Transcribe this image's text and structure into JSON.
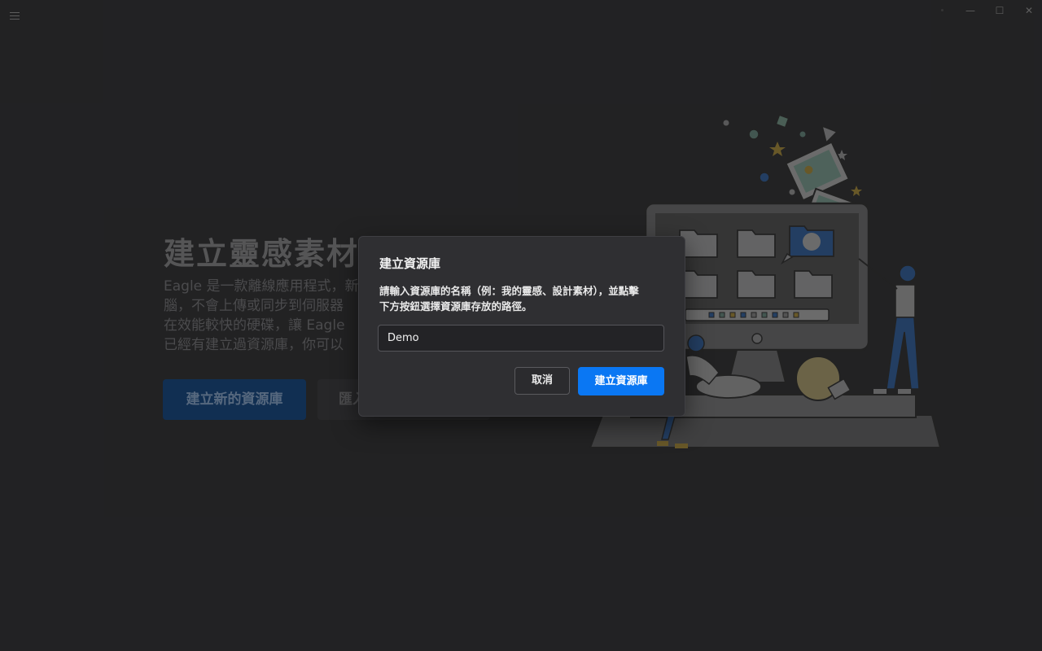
{
  "window": {
    "menu_icon": "hamburger-menu-icon",
    "minimize_glyph": "—",
    "maximize_glyph": "☐",
    "close_glyph": "✕"
  },
  "welcome": {
    "title": "建立靈感素材庫",
    "description_lines": [
      "Eagle 是一款離線應用程式，新",
      "腦，不會上傳或同步到伺服器",
      "在效能較快的硬碟，讓 Eagle",
      "已經有建立過資源庫，你可以"
    ],
    "create_button": "建立新的資源庫",
    "import_button": "匯入"
  },
  "dialog": {
    "title": "建立資源庫",
    "message_line1": "請輸入資源庫的名稱（例：我的靈感、設計素材），並點擊",
    "message_line2": "下方按鈕選擇資源庫存放的路徑。",
    "input_value": "Demo",
    "cancel_label": "取消",
    "confirm_label": "建立資源庫"
  },
  "colors": {
    "background": "#2a2a2c",
    "dialog_bg": "#2f2f32",
    "accent": "#0a77f3"
  }
}
